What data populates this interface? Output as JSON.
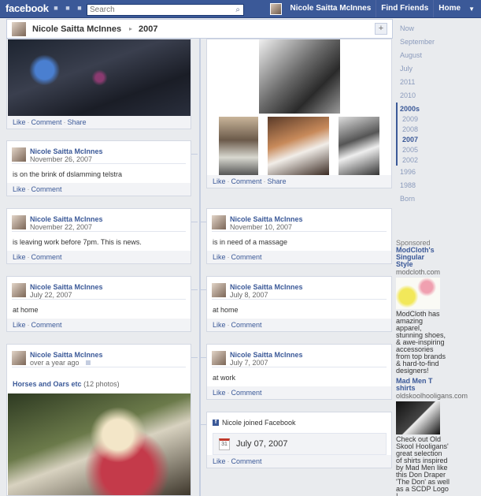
{
  "topbar": {
    "logo": "facebook",
    "search_placeholder": "Search",
    "user_name": "Nicole Saitta McInnes",
    "find_friends": "Find Friends",
    "home": "Home"
  },
  "header": {
    "name": "Nicole Saitta McInnes",
    "separator": "▸",
    "year": "2007",
    "plus": "+"
  },
  "actions": {
    "like": "Like",
    "comment": "Comment",
    "share": "Share",
    "dot": "·"
  },
  "left_posts": [
    {
      "author": "Nicole Saitta McInnes",
      "date": "November 26, 2007",
      "text": "is on the brink of dslamming telstra"
    },
    {
      "author": "Nicole Saitta McInnes",
      "date": "November 22, 2007",
      "text": "is leaving work before 7pm. This is news."
    },
    {
      "author": "Nicole Saitta McInnes",
      "date": "July 22, 2007",
      "text": "at home"
    },
    {
      "author": "Nicole Saitta McInnes",
      "date": "over a year ago",
      "album_title": "Horses and Oars etc",
      "album_count": "(12 photos)"
    }
  ],
  "right_posts": [
    {
      "author": "Nicole Saitta McInnes",
      "date": "November 10, 2007",
      "text": "is in need of a massage"
    },
    {
      "author": "Nicole Saitta McInnes",
      "date": "July 8, 2007",
      "text": "at home"
    },
    {
      "author": "Nicole Saitta McInnes",
      "date": "July 7, 2007",
      "text": "at work"
    }
  ],
  "joined": {
    "text": "Nicole joined Facebook",
    "calendar_day": "31",
    "date": "July 07, 2007"
  },
  "years": [
    "Now",
    "September",
    "August",
    "July",
    "2011",
    "2010",
    "2000s",
    "2009",
    "2008",
    "2007",
    "2005",
    "2002",
    "1996",
    "1988",
    "Born"
  ],
  "sponsored": {
    "label": "Sponsored",
    "ads": [
      {
        "title": "ModCloth's Singular Style",
        "domain": "modcloth.com",
        "body": "ModCloth has amazing apparel, stunning shoes, & awe-inspiring accessories from top brands & hard-to-find designers!"
      },
      {
        "title": "Mad Men T shirts",
        "domain": "oldskoolhooligans.com",
        "body": "Check out Old Skool Hooligans' great selection of shirts inspired by Mad Men like this Don Draper 'The Don' as well as a SCDP Logo !"
      }
    ]
  },
  "colors": {
    "brand": "#3b5998",
    "background": "#e9ebee",
    "link": "#3b5998"
  }
}
